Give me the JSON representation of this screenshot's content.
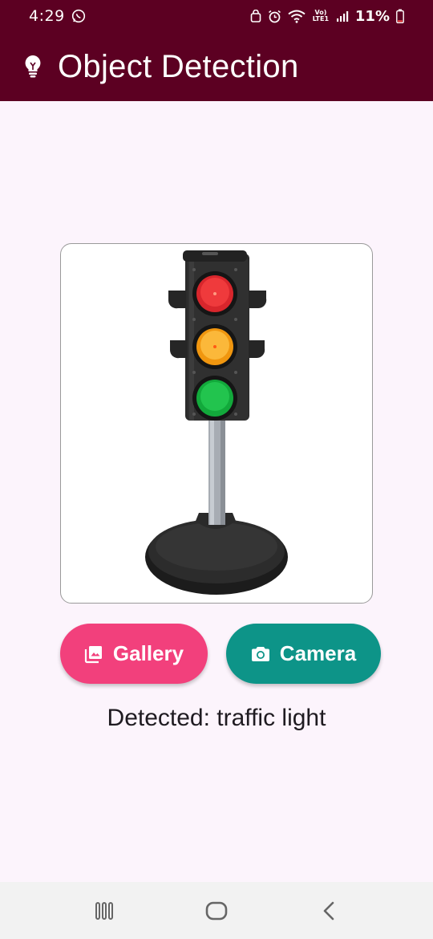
{
  "status_bar": {
    "time": "4:29",
    "battery_text": "11%",
    "network_label": "Vo) LTE1"
  },
  "app_bar": {
    "title": "Object Detection",
    "icon": "lightbulb-icon",
    "background": "#5c0022"
  },
  "preview": {
    "image_subject": "traffic light"
  },
  "buttons": {
    "gallery_label": "Gallery",
    "gallery_icon": "photo-library-icon",
    "gallery_color": "#f2407c",
    "camera_label": "Camera",
    "camera_icon": "camera-icon",
    "camera_color": "#0d9488"
  },
  "result": {
    "detected_text": "Detected: traffic light"
  },
  "nav": {
    "recents_icon": "recents-icon",
    "home_icon": "home-icon",
    "back_icon": "back-icon"
  }
}
